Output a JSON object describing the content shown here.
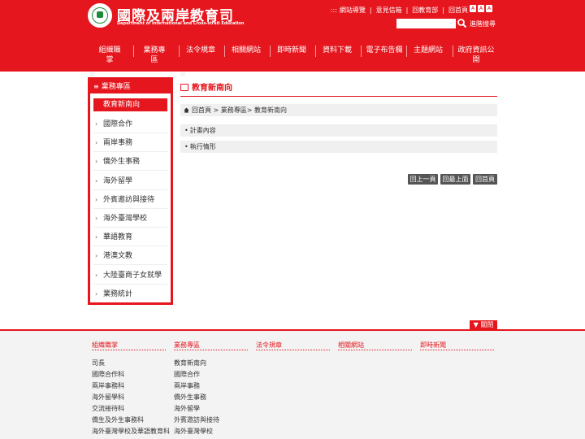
{
  "header": {
    "title": "國際及兩岸教育司",
    "subtitle": "Department of International and Cross-strait Education",
    "toplinks_dots": ":::",
    "toplinks": [
      "網站導覽",
      "意見信箱",
      "回教育部",
      "回首頁"
    ],
    "font_sizes": [
      "A",
      "A",
      "A"
    ],
    "search_placeholder": "",
    "search_label": "進階搜尋",
    "accent_color": "#e5161d"
  },
  "nav": [
    "組織職掌",
    "業務專區",
    "法令規章",
    "相關網站",
    "即時新聞",
    "資料下載",
    "電子布告欄",
    "主題網站",
    "政府資訊公",
    "開"
  ],
  "sidebar": {
    "dots": ":::",
    "title": "業務專區",
    "items": [
      "教育新南向",
      "國際合作",
      "兩岸事務",
      "僑外生事務",
      "海外留學",
      "外賓邀訪與接待",
      "海外臺灣學校",
      "華語教育",
      "港澳文教",
      "大陸臺商子女就學",
      "業務統計"
    ]
  },
  "content": {
    "dots": ":::",
    "title": "教育新南向",
    "breadcrumb": "回首頁 > 業務專區> 教育新南向",
    "rows": [
      "計畫內容",
      "執行情形"
    ],
    "buttons": [
      "回上一頁",
      "回最上面",
      "回首頁"
    ]
  },
  "footer": {
    "close_label": "▼ 關閉",
    "columns": [
      {
        "head": "組織職掌",
        "items": [
          "司長",
          "國際合作科",
          "兩岸事務科",
          "海外留學科",
          "交流接待科",
          "僑生及外生事務科",
          "海外臺灣學校及華語教育科"
        ]
      },
      {
        "head": "業務專區",
        "items": [
          "教育新南向",
          "國際合作",
          "兩岸事務",
          "僑外生事務",
          "海外留學",
          "外賓邀訪與接待",
          "海外臺灣學校"
        ]
      },
      {
        "head": "法令規章",
        "items": []
      },
      {
        "head": "相關網站",
        "items": []
      },
      {
        "head": "即時新聞",
        "items": []
      }
    ]
  }
}
